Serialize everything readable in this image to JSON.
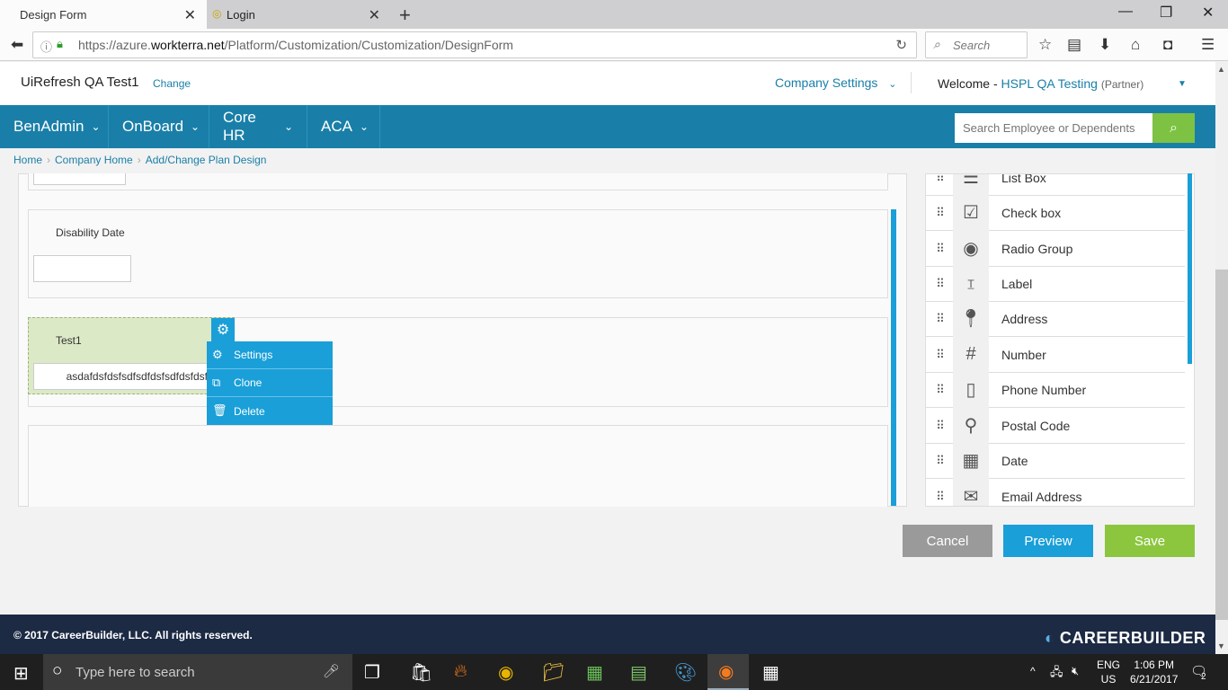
{
  "browser": {
    "tabs": [
      {
        "label": "Design Form"
      },
      {
        "label": "Login"
      }
    ],
    "url": {
      "prefix": "https://azure.",
      "domain": "workterra.net",
      "path": "/Platform/Customization/Customization/DesignForm"
    },
    "search_placeholder": "Search"
  },
  "header": {
    "company": "UiRefresh QA Test1",
    "change": "Change",
    "company_settings": "Company Settings",
    "welcome": "Welcome -",
    "user": "HSPL QA Testing",
    "role": "(Partner)"
  },
  "menu": {
    "items": [
      {
        "label": "BenAdmin"
      },
      {
        "label": "OnBoard"
      },
      {
        "label": "Core HR"
      },
      {
        "label": "ACA"
      }
    ],
    "search_placeholder": "Search Employee or Dependents"
  },
  "breadcrumb": [
    "Home",
    "Company Home",
    "Add/Change Plan Design"
  ],
  "form": {
    "disability_label": "Disability Date",
    "test1_label": "Test1",
    "test1_value": "asdafdsfdsfsdfsdfdsfsdfdsfdsf"
  },
  "context_menu": {
    "settings": "Settings",
    "clone": "Clone",
    "delete": "Delete"
  },
  "palette": {
    "items": [
      {
        "label": "List Box",
        "icon": "list-icon"
      },
      {
        "label": "Check box",
        "icon": "checkbox-icon"
      },
      {
        "label": "Radio Group",
        "icon": "radio-icon"
      },
      {
        "label": "Label",
        "icon": "text-label-icon"
      },
      {
        "label": "Address",
        "icon": "map-pin-icon"
      },
      {
        "label": "Number",
        "icon": "hash-icon"
      },
      {
        "label": "Phone Number",
        "icon": "phone-icon"
      },
      {
        "label": "Postal Code",
        "icon": "postal-pin-icon"
      },
      {
        "label": "Date",
        "icon": "calendar-icon"
      },
      {
        "label": "Email Address",
        "icon": "envelope-icon"
      }
    ]
  },
  "buttons": {
    "cancel": "Cancel",
    "preview": "Preview",
    "save": "Save"
  },
  "colors": {
    "primary": "#1a7fa8",
    "accent": "#1a9fd8",
    "save": "#8cc63f",
    "cancel": "#9a9a9a",
    "selected_field": "#dbe9c6"
  },
  "footer": {
    "copyright": "© 2017 CareerBuilder, LLC. All rights reserved.",
    "logo": "CAREERBUILDER"
  },
  "taskbar": {
    "search_placeholder": "Type here to search",
    "lang_top": "ENG",
    "lang_bottom": "US",
    "time": "1:06 PM",
    "date": "6/21/2017",
    "notifications": "2"
  }
}
